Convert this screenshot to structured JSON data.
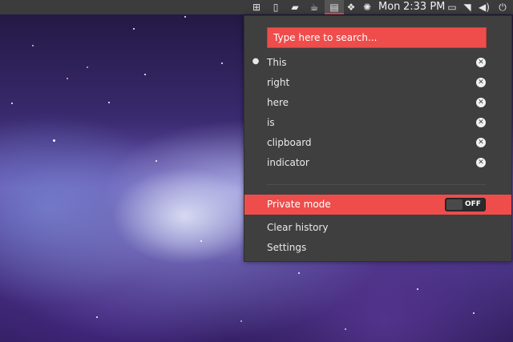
{
  "topbar": {
    "day": "Mon",
    "time": "2:33 PM",
    "icons": [
      "network-wired-icon",
      "phone-icon",
      "sd-card-icon",
      "coffee-icon",
      "clipboard-indicator-icon",
      "dropbox-icon",
      "gear-burst-icon",
      "display-icon",
      "screens-icon",
      "wifi-icon",
      "volume-icon",
      "power-icon"
    ]
  },
  "search": {
    "placeholder": "Type here to search..."
  },
  "history": {
    "items": [
      {
        "label": "This",
        "active": true
      },
      {
        "label": "right",
        "active": false
      },
      {
        "label": "here",
        "active": false
      },
      {
        "label": "is",
        "active": false
      },
      {
        "label": "clipboard",
        "active": false
      },
      {
        "label": "indicator",
        "active": false
      }
    ]
  },
  "private_mode": {
    "label": "Private mode",
    "state": "OFF"
  },
  "actions": {
    "clear_history": "Clear history",
    "settings": "Settings"
  },
  "colors": {
    "accent": "#ee4d4b",
    "panel": "#3c3c3c",
    "menu": "#3f3f3f"
  }
}
